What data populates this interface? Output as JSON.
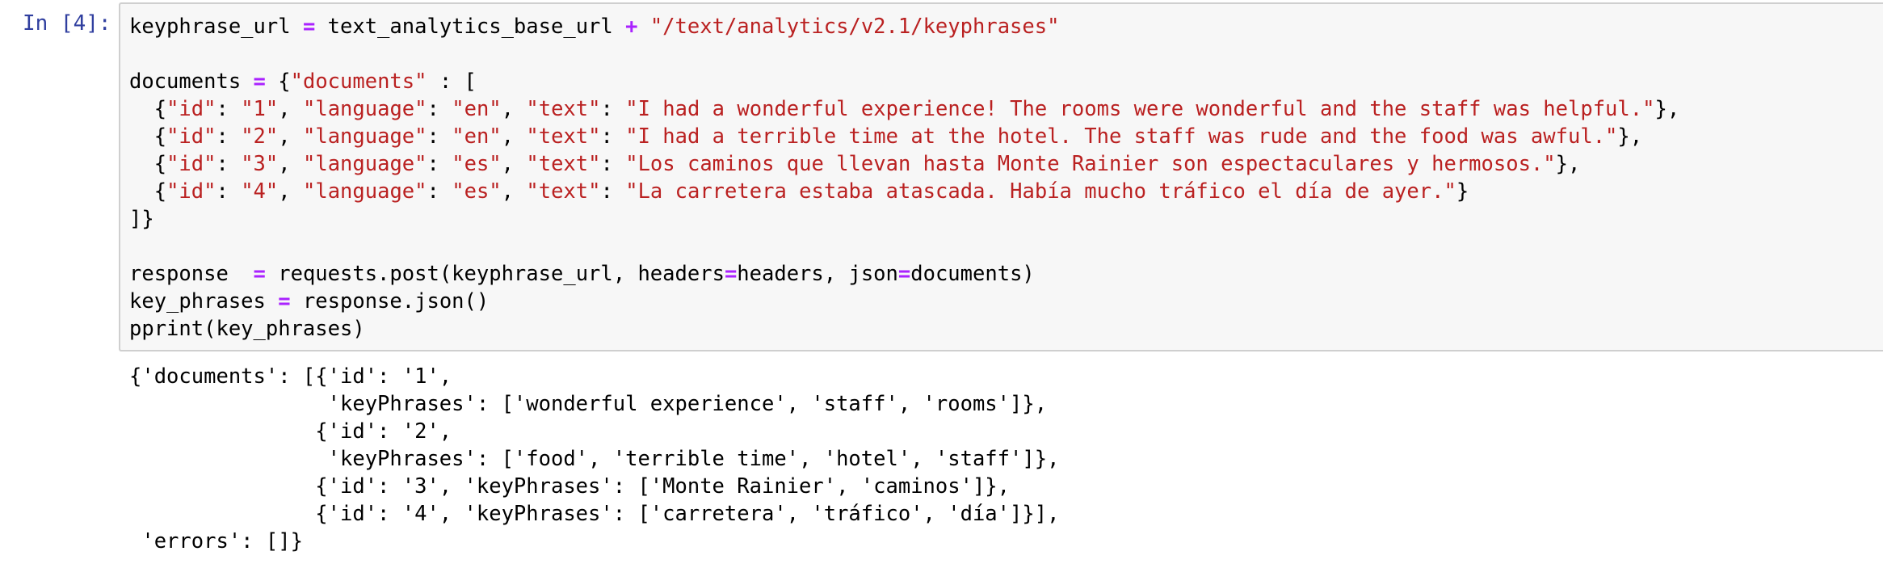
{
  "cell": {
    "prompt": "In [4]:",
    "input_lines": [
      [
        [
          "t",
          "keyphrase_url "
        ],
        [
          "o",
          "="
        ],
        [
          "t",
          " text_analytics_base_url "
        ],
        [
          "o",
          "+"
        ],
        [
          "t",
          " "
        ],
        [
          "s",
          "\"/text/analytics/v2.1/keyphrases\""
        ]
      ],
      [],
      [
        [
          "t",
          "documents "
        ],
        [
          "o",
          "="
        ],
        [
          "t",
          " {"
        ],
        [
          "s",
          "\"documents\""
        ],
        [
          "t",
          " : ["
        ]
      ],
      [
        [
          "t",
          "  {"
        ],
        [
          "s",
          "\"id\""
        ],
        [
          "t",
          ": "
        ],
        [
          "s",
          "\"1\""
        ],
        [
          "t",
          ", "
        ],
        [
          "s",
          "\"language\""
        ],
        [
          "t",
          ": "
        ],
        [
          "s",
          "\"en\""
        ],
        [
          "t",
          ", "
        ],
        [
          "s",
          "\"text\""
        ],
        [
          "t",
          ": "
        ],
        [
          "s",
          "\"I had a wonderful experience! The rooms were wonderful and the staff was helpful.\""
        ],
        [
          "t",
          "},"
        ]
      ],
      [
        [
          "t",
          "  {"
        ],
        [
          "s",
          "\"id\""
        ],
        [
          "t",
          ": "
        ],
        [
          "s",
          "\"2\""
        ],
        [
          "t",
          ", "
        ],
        [
          "s",
          "\"language\""
        ],
        [
          "t",
          ": "
        ],
        [
          "s",
          "\"en\""
        ],
        [
          "t",
          ", "
        ],
        [
          "s",
          "\"text\""
        ],
        [
          "t",
          ": "
        ],
        [
          "s",
          "\"I had a terrible time at the hotel. The staff was rude and the food was awful.\""
        ],
        [
          "t",
          "},"
        ]
      ],
      [
        [
          "t",
          "  {"
        ],
        [
          "s",
          "\"id\""
        ],
        [
          "t",
          ": "
        ],
        [
          "s",
          "\"3\""
        ],
        [
          "t",
          ", "
        ],
        [
          "s",
          "\"language\""
        ],
        [
          "t",
          ": "
        ],
        [
          "s",
          "\"es\""
        ],
        [
          "t",
          ", "
        ],
        [
          "s",
          "\"text\""
        ],
        [
          "t",
          ": "
        ],
        [
          "s",
          "\"Los caminos que llevan hasta Monte Rainier son espectaculares y hermosos.\""
        ],
        [
          "t",
          "},"
        ]
      ],
      [
        [
          "t",
          "  {"
        ],
        [
          "s",
          "\"id\""
        ],
        [
          "t",
          ": "
        ],
        [
          "s",
          "\"4\""
        ],
        [
          "t",
          ", "
        ],
        [
          "s",
          "\"language\""
        ],
        [
          "t",
          ": "
        ],
        [
          "s",
          "\"es\""
        ],
        [
          "t",
          ", "
        ],
        [
          "s",
          "\"text\""
        ],
        [
          "t",
          ": "
        ],
        [
          "s",
          "\"La carretera estaba atascada. Había mucho tráfico el día de ayer.\""
        ],
        [
          "t",
          "}"
        ]
      ],
      [
        [
          "t",
          "]}"
        ]
      ],
      [],
      [
        [
          "t",
          "response  "
        ],
        [
          "o",
          "="
        ],
        [
          "t",
          " requests.post(keyphrase_url, headers"
        ],
        [
          "o",
          "="
        ],
        [
          "t",
          "headers, json"
        ],
        [
          "o",
          "="
        ],
        [
          "t",
          "documents)"
        ]
      ],
      [
        [
          "t",
          "key_phrases "
        ],
        [
          "o",
          "="
        ],
        [
          "t",
          " response.json()"
        ]
      ],
      [
        [
          "t",
          "pprint(key_phrases)"
        ]
      ]
    ],
    "output_lines": [
      "{'documents': [{'id': '1',",
      "                'keyPhrases': ['wonderful experience', 'staff', 'rooms']},",
      "               {'id': '2',",
      "                'keyPhrases': ['food', 'terrible time', 'hotel', 'staff']},",
      "               {'id': '3', 'keyPhrases': ['Monte Rainier', 'caminos']},",
      "               {'id': '4', 'keyPhrases': ['carretera', 'tráfico', 'día']}],",
      " 'errors': []}"
    ]
  },
  "colors": {
    "prompt": "#303f9f",
    "string": "#ba2121",
    "operator": "#aa22ff",
    "input_bg": "#f7f7f7",
    "input_border": "#cfcfcf"
  }
}
